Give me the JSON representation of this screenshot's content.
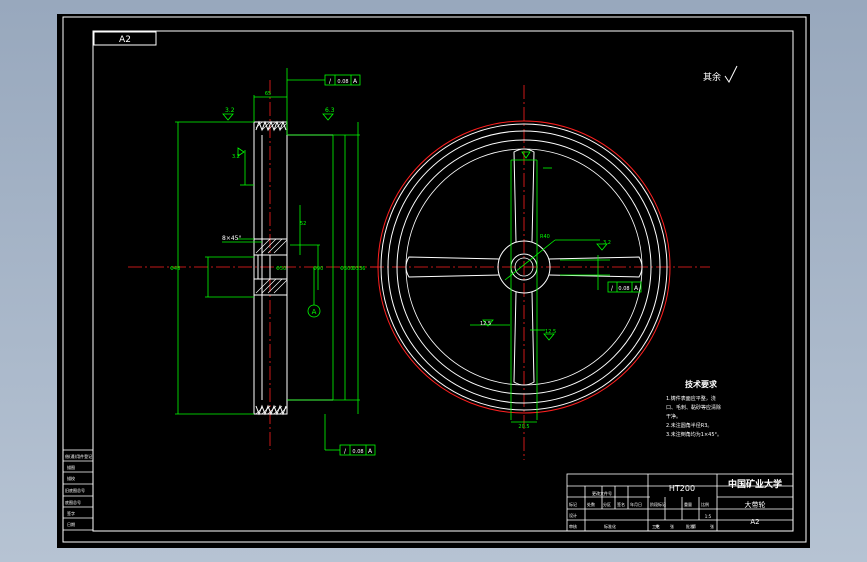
{
  "sheet": {
    "size_tag": "A2",
    "background": "#000000",
    "frame_color": "#ffffff"
  },
  "colors": {
    "outline": "#ffffff",
    "dimension": "#00ff00",
    "centerline": "#ff2020",
    "hatch": "#ffffff"
  },
  "top_right": {
    "roughness_note": "其余",
    "roughness_symbol": "check-mark-icon"
  },
  "section_view": {
    "roughness_left": "3.2",
    "roughness_right": "6.3",
    "roughness_side": "3.2",
    "chamfer": "8×45°",
    "datum_label": "A",
    "tol_top": [
      "/",
      "0.08",
      "A"
    ],
    "tol_bottom": [
      "/",
      "0.08",
      "A"
    ],
    "dim_labels": [
      "65",
      "52",
      "Φ50",
      "Φ90",
      "Φ300",
      "Φ336",
      "Φ48"
    ]
  },
  "front_view": {
    "hub_label": "R40",
    "rough_labels": [
      "3.2",
      "12.5",
      "12.5"
    ],
    "tol_right": [
      "/",
      "0.08",
      "A"
    ],
    "bottom_label": "20.5"
  },
  "tech_requirements": {
    "title": "技术要求",
    "lines": [
      "1.铸件表面应平整，浇",
      "口、毛刺、黏砂等应清除",
      "干净。",
      "2.未注圆角半径R3。",
      "3.未注倒角均为1×45°。"
    ]
  },
  "title_block": {
    "material": "HT200",
    "school": "中国矿业大学",
    "part_name": "大带轮",
    "sheet_size": "A2",
    "scale_label": "1:5",
    "row_labels": [
      "标记",
      "处数",
      "分区",
      "更改文件号",
      "签名",
      "年月日"
    ],
    "bottom_labels": [
      "设计",
      "标准化",
      "审核",
      "工艺",
      "批准"
    ],
    "stage_labels": [
      "阶段标记",
      "重量",
      "比例"
    ],
    "sheet_count": [
      "共",
      "张",
      "第",
      "张"
    ]
  },
  "left_block": {
    "labels": [
      "借(通)用件登记",
      "描图",
      "描校",
      "旧底图总号",
      "底图总号",
      "签字",
      "日期"
    ]
  }
}
